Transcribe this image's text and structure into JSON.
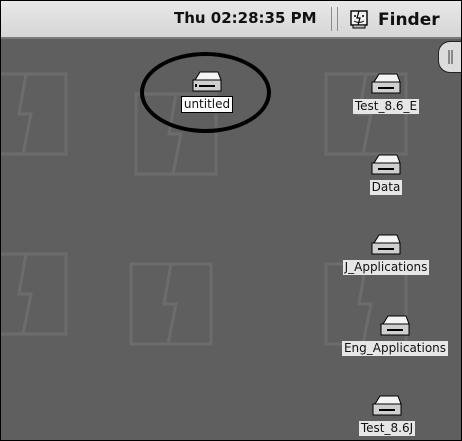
{
  "menubar": {
    "clock": "Thu 02:28:35 PM",
    "app_menu_label": "Finder",
    "app_menu_icon": "finder-icon"
  },
  "desktop": {
    "icons": [
      {
        "label": "untitled",
        "icon": "hard-drive-icon",
        "selected": true
      },
      {
        "label": "Test_8.6_E",
        "icon": "hard-drive-icon"
      },
      {
        "label": "Data",
        "icon": "hard-drive-icon"
      },
      {
        "label": "J_Applications",
        "icon": "hard-drive-icon"
      },
      {
        "label": "Eng_Applications",
        "icon": "hard-drive-icon"
      },
      {
        "label": "Test_8.6J",
        "icon": "hard-drive-icon"
      }
    ]
  },
  "colors": {
    "desktop": "#5f5f5f",
    "menubar": "#dcdcdc",
    "annotation_ring": "#000000"
  }
}
